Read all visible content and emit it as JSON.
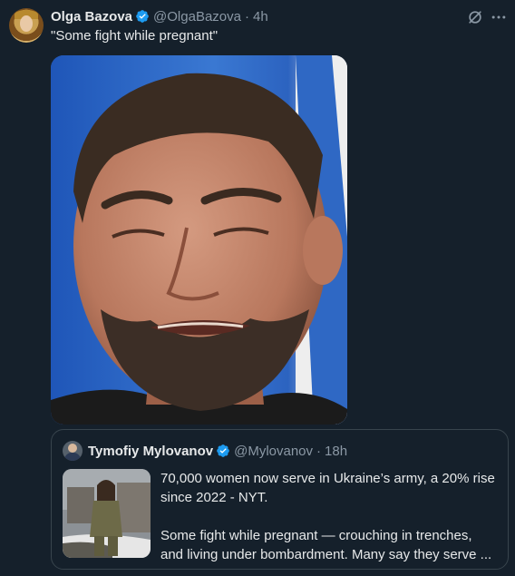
{
  "tweet": {
    "author_name": "Olga Bazova",
    "author_handle": "@OlgaBazova",
    "separator": "·",
    "time": "4h",
    "text": "\"Some fight while pregnant\"",
    "avatar_icon": "avatar-portrait",
    "media_icon": "photo-man-grimacing-flag-background"
  },
  "quoted": {
    "author_name": "Tymofiy Mylovanov",
    "author_handle": "@Mylovanov",
    "separator": "·",
    "time": "18h",
    "text_lines_1": [
      "70,000 women now serve in Ukraine’s army, a 20% rise",
      "since 2022 - NYT."
    ],
    "text_lines_2": [
      "Some fight while pregnant — crouching in trenches,",
      "and living under bombardment. Many say they serve ..."
    ],
    "thumb_icon": "photo-woman-soldier"
  },
  "icons": [
    "verified-badge-icon",
    "grok-icon",
    "more-icon"
  ],
  "colors": {
    "background": "#15202b",
    "text": "#e7e9ea",
    "muted": "#8b98a5",
    "verified": "#1d9bf0",
    "border": "#38444d"
  }
}
